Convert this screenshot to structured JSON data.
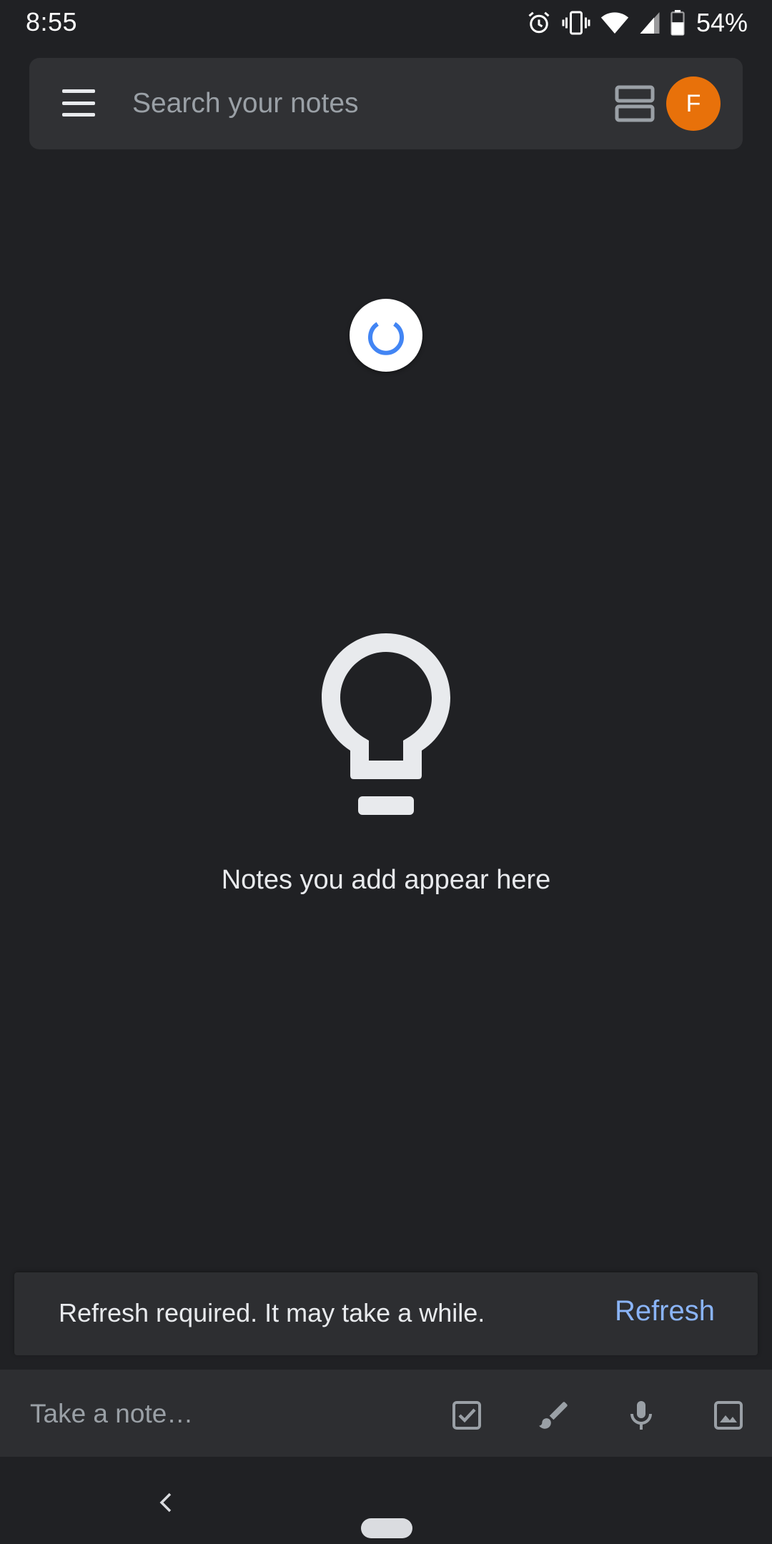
{
  "status_bar": {
    "time": "8:55",
    "battery_percent": "54%",
    "icons": [
      "alarm-icon",
      "vibrate-icon",
      "wifi-icon",
      "cell-signal-icon",
      "battery-icon"
    ]
  },
  "search": {
    "placeholder": "Search your notes",
    "account_initial": "F",
    "avatar_color": "#e8710a"
  },
  "empty_state": {
    "message": "Notes you add appear here",
    "icon": "lightbulb-icon"
  },
  "snackbar": {
    "message": "Refresh required. It may take a while.",
    "action_label": "Refresh",
    "action_color": "#8ab4f8"
  },
  "note_bar": {
    "placeholder": "Take a note…",
    "tools": [
      "checkbox-icon",
      "brush-icon",
      "mic-icon",
      "image-icon"
    ]
  },
  "colors": {
    "background": "#202124",
    "surface": "#303134",
    "spinner_accent": "#4285f4"
  }
}
